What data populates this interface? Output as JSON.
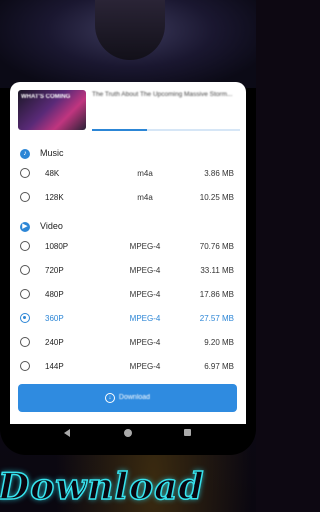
{
  "video_title": "The Truth About The Upcoming Massive Storm...",
  "thumbnail_text": "WHAT'S COMING",
  "progress": 0.37,
  "sections": [
    {
      "label": "Music",
      "icon": "music-note-icon"
    },
    {
      "label": "Video",
      "icon": "play-icon"
    }
  ],
  "music": [
    {
      "quality": "48K",
      "format": "m4a",
      "size": "3.86 MB"
    },
    {
      "quality": "128K",
      "format": "m4a",
      "size": "10.25 MB"
    }
  ],
  "video": [
    {
      "quality": "1080P",
      "format": "MPEG-4",
      "size": "70.76 MB"
    },
    {
      "quality": "720P",
      "format": "MPEG-4",
      "size": "33.11 MB"
    },
    {
      "quality": "480P",
      "format": "MPEG-4",
      "size": "17.86 MB"
    },
    {
      "quality": "360P",
      "format": "MPEG-4",
      "size": "27.57 MB"
    },
    {
      "quality": "240P",
      "format": "MPEG-4",
      "size": "9.20 MB"
    },
    {
      "quality": "144P",
      "format": "MPEG-4",
      "size": "6.97 MB"
    }
  ],
  "selected": "360P",
  "download_label": "Download",
  "promo_text": "Download",
  "colors": {
    "accent": "#2c86d6",
    "promo": "#37e3ee"
  }
}
